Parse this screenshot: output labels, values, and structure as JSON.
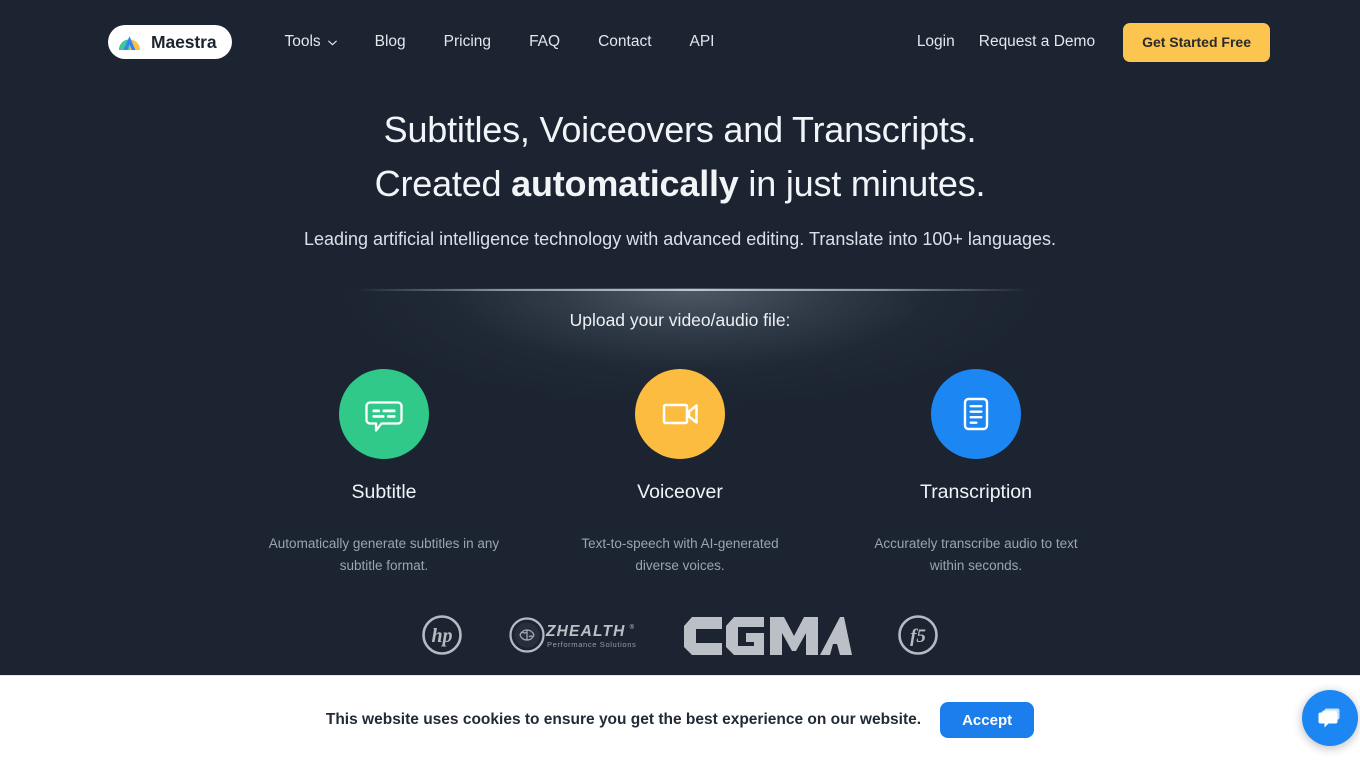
{
  "brand": {
    "name": "Maestra",
    "logo_icon": "maestra-m-logo",
    "colors": {
      "green": "#3ec79a",
      "blue": "#2f86f0",
      "yellow": "#fbc14c"
    }
  },
  "header": {
    "nav": [
      {
        "label": "Tools",
        "has_dropdown": true,
        "icon": "chevron-down-icon"
      },
      {
        "label": "Blog",
        "has_dropdown": false
      },
      {
        "label": "Pricing",
        "has_dropdown": false
      },
      {
        "label": "FAQ",
        "has_dropdown": false
      },
      {
        "label": "Contact",
        "has_dropdown": false
      },
      {
        "label": "API",
        "has_dropdown": false
      }
    ],
    "login_label": "Login",
    "demo_label": "Request a Demo",
    "cta_label": "Get Started Free",
    "cta_color": "#fcc550"
  },
  "hero": {
    "headline_line1": "Subtitles, Voiceovers and Transcripts.",
    "headline_line2_pre": "Created ",
    "headline_line2_bold": "automatically",
    "headline_line2_post": " in just minutes.",
    "subheadline": "Leading artificial intelligence technology with advanced editing. Translate into 100+ languages."
  },
  "upload": {
    "label": "Upload your video/audio file:",
    "cards": [
      {
        "title": "Subtitle",
        "description": "Automatically generate subtitles in any subtitle format.",
        "icon": "subtitle-bubble-icon",
        "color": "#30c98a"
      },
      {
        "title": "Voiceover",
        "description": "Text-to-speech with AI-generated diverse voices.",
        "icon": "video-camera-icon",
        "color": "#fcbc3f"
      },
      {
        "title": "Transcription",
        "description": "Accurately transcribe audio to text within seconds.",
        "icon": "document-lines-icon",
        "color": "#1c87f2"
      }
    ]
  },
  "clients": [
    {
      "name": "hp",
      "icon": "hp-logo"
    },
    {
      "name": "ZHEALTH",
      "tagline": "Performance Solutions",
      "icon": "zhealth-logo"
    },
    {
      "name": "CGMA",
      "icon": "cgma-logo"
    },
    {
      "name": "f5",
      "icon": "f5-logo"
    }
  ],
  "cookie_banner": {
    "message": "This website uses cookies to ensure you get the best experience on our website.",
    "accept_label": "Accept",
    "accept_color": "#1c7ded"
  },
  "chat": {
    "icon": "chat-bubbles-icon",
    "color": "#1c87f2"
  }
}
